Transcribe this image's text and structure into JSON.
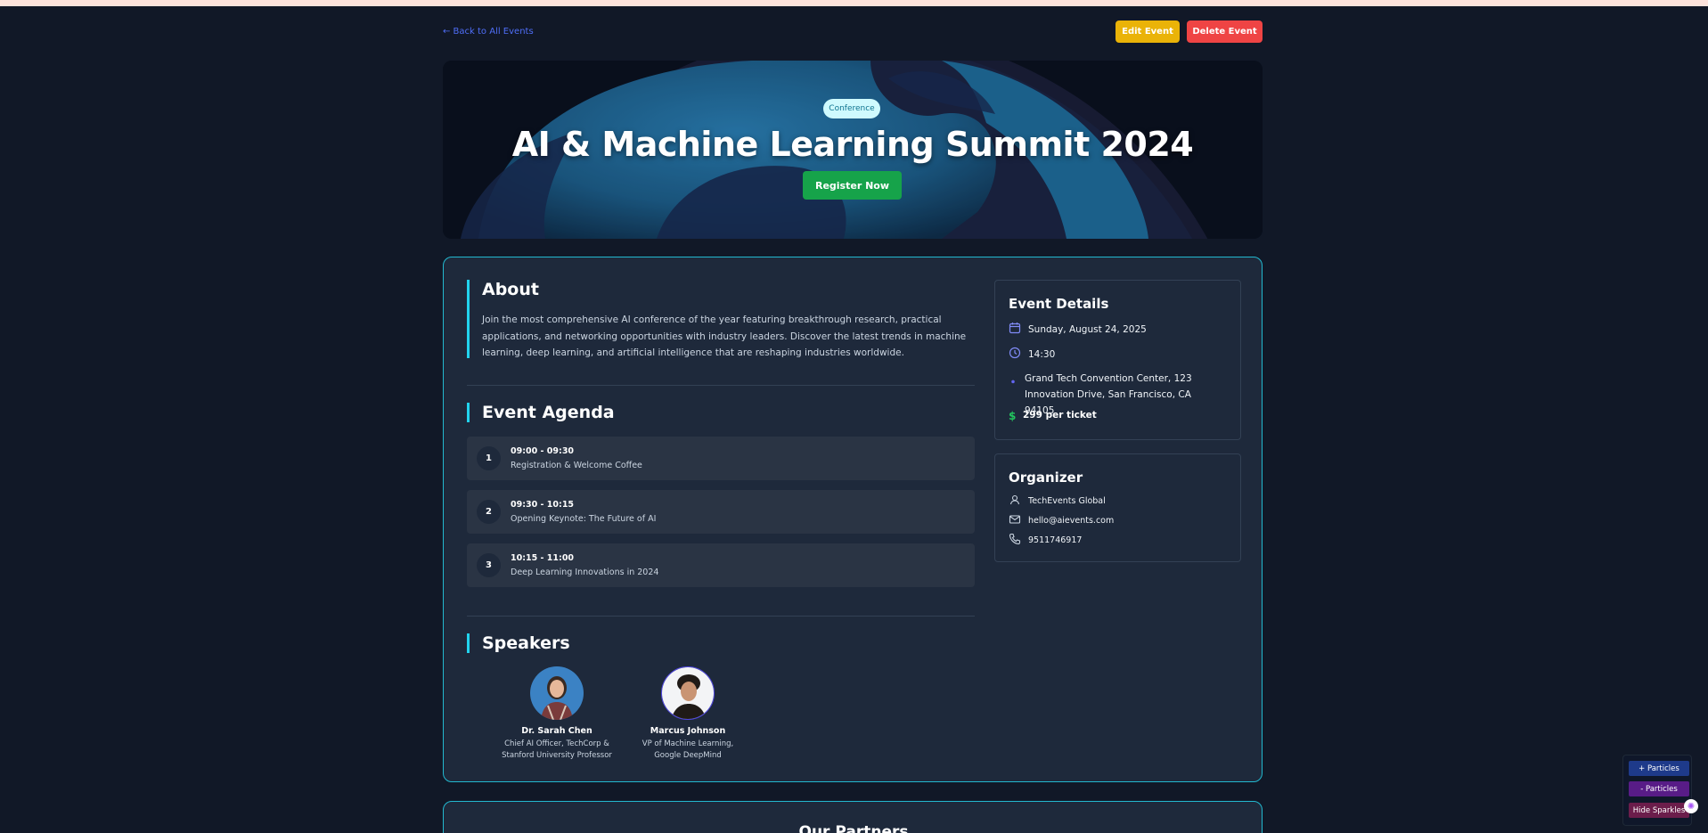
{
  "nav": {
    "back_label": "← Back to All Events",
    "edit_label": "Edit Event",
    "delete_label": "Delete Event"
  },
  "hero": {
    "badge": "Conference",
    "title": "AI & Machine Learning Summit 2024",
    "register_label": "Register Now"
  },
  "about": {
    "heading": "About",
    "text": "Join the most comprehensive AI conference of the year featuring breakthrough research, practical applications, and networking opportunities with industry leaders. Discover the latest trends in machine learning, deep learning, and artificial intelligence that are reshaping industries worldwide."
  },
  "agenda": {
    "heading": "Event Agenda",
    "items": [
      {
        "num": "1",
        "time": "09:00 - 09:30",
        "title": "Registration & Welcome Coffee"
      },
      {
        "num": "2",
        "time": "09:30 - 10:15",
        "title": "Opening Keynote: The Future of AI"
      },
      {
        "num": "3",
        "time": "10:15 - 11:00",
        "title": "Deep Learning Innovations in 2024"
      }
    ]
  },
  "speakers": {
    "heading": "Speakers",
    "items": [
      {
        "name": "Dr. Sarah Chen",
        "role": "Chief AI Officer, TechCorp & Stanford University Professor"
      },
      {
        "name": "Marcus Johnson",
        "role": "VP of Machine Learning, Google DeepMind"
      }
    ]
  },
  "details": {
    "heading": "Event Details",
    "date": "Sunday, August 24, 2025",
    "time": "14:30",
    "location": "Grand Tech Convention Center, 123 Innovation Drive, San Francisco, CA 94105",
    "price": "299 per ticket"
  },
  "organizer": {
    "heading": "Organizer",
    "name": "TechEvents Global",
    "email": "hello@aievents.com",
    "phone": "9511746917"
  },
  "partners": {
    "heading": "Our Partners"
  },
  "particles": {
    "add_label": "+ Particles",
    "remove_label": "- Particles",
    "hide_label": "Hide Sparkles"
  },
  "colors": {
    "accent": "#22d3ee",
    "register": "#16a34a",
    "edit": "#eab308",
    "delete": "#ef4444",
    "link": "#4f6ef7"
  }
}
